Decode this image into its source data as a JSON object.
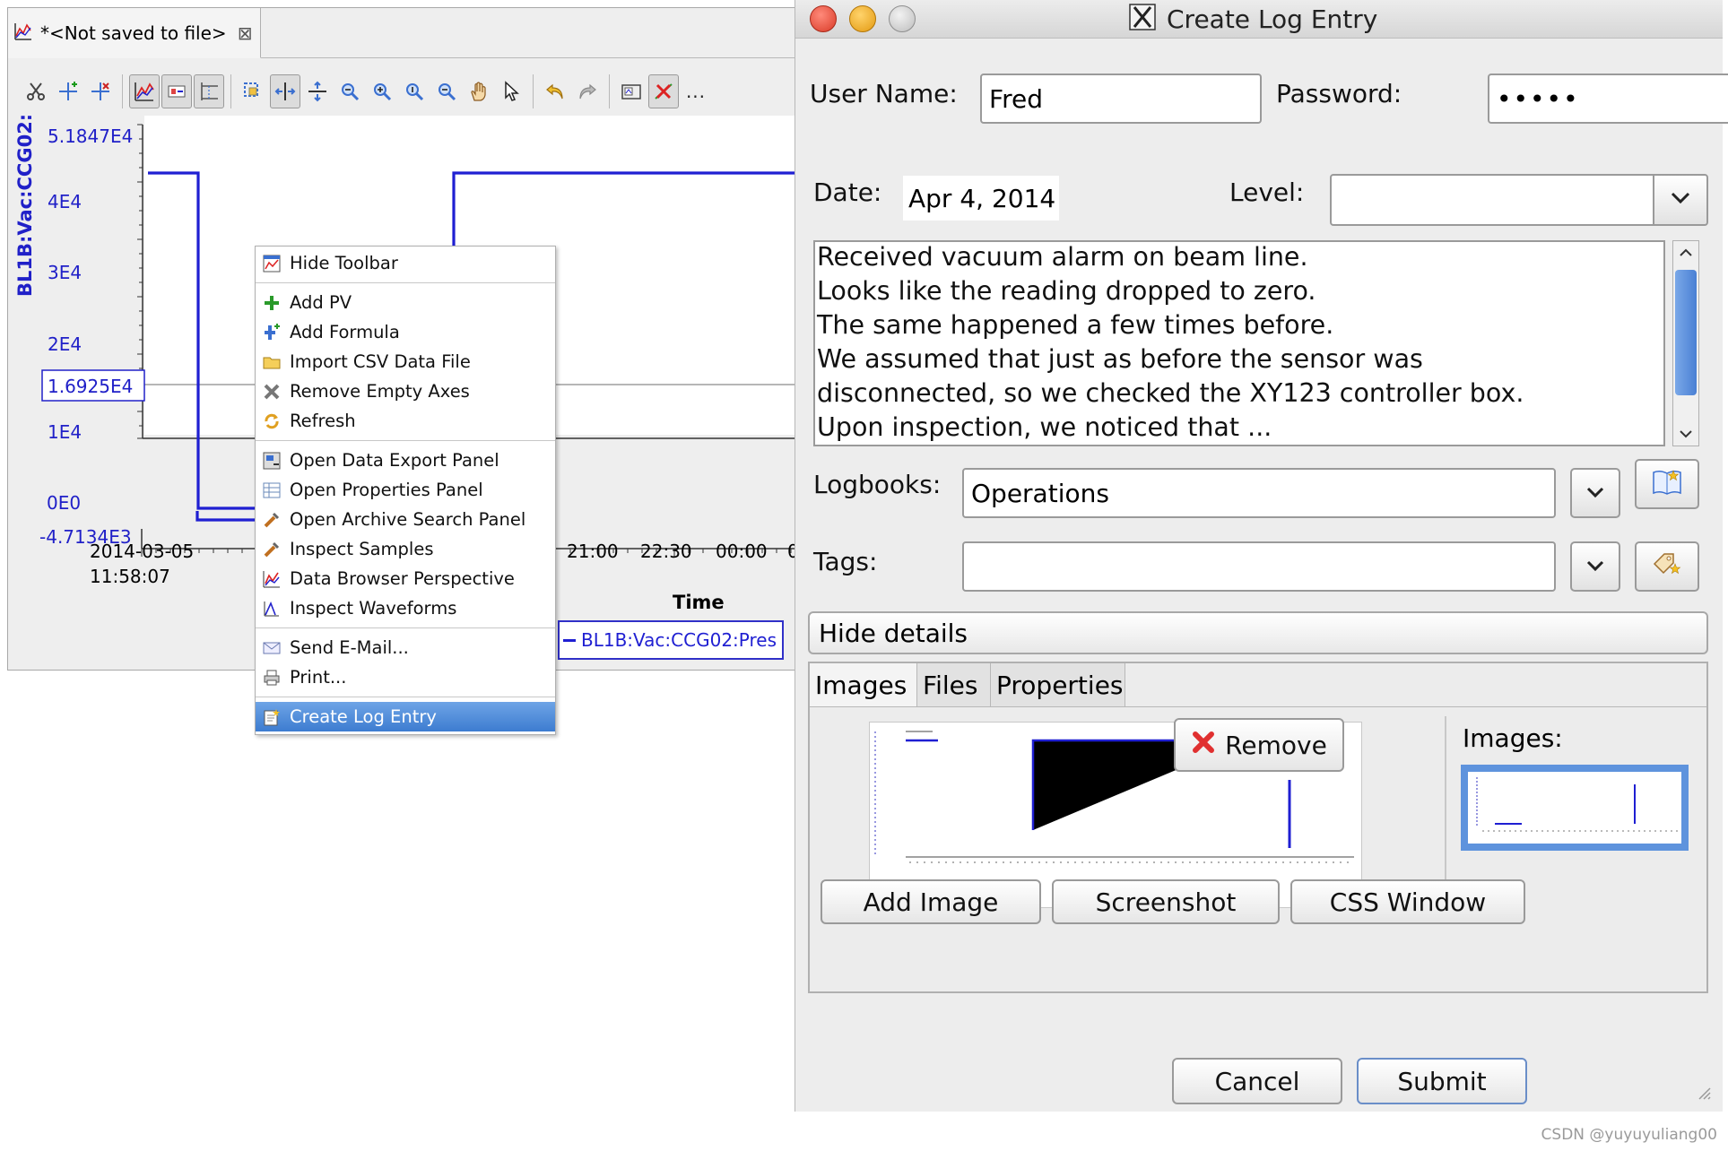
{
  "editor": {
    "tab_title": "*<Not saved to file>",
    "tab_close": "⊠"
  },
  "toolbar": {
    "icons": [
      "scissors-icon",
      "add-cursor-icon",
      "remove-cursor-icon",
      "chart-icon",
      "legend-icon",
      "grid-icon",
      "zoom-box-icon",
      "zoom-x-icon",
      "zoom-y-icon",
      "zoom-in-x-icon",
      "zoom-out-x-icon",
      "zoom-in-y-icon",
      "zoom-out-y-icon",
      "pan-icon",
      "pointer-icon",
      "undo-icon",
      "redo-icon",
      "snapshot-icon",
      "stop-icon"
    ],
    "more_label": "..."
  },
  "plot": {
    "y_axis_label": "BL1B:Vac:CCG02:Pres",
    "y_ticks": [
      "5.1847E4",
      "4E4",
      "3E4",
      "2E4",
      "1E4",
      "0E0",
      "-4.7134E3"
    ],
    "y_readout": "1.6925E4",
    "x_tick_first_date": "2014-03-05",
    "x_tick_first_time": "11:58:07",
    "x_ticks": [
      "21:00",
      "22:30",
      "00:00",
      "0"
    ],
    "x_axis_label": "Time",
    "legend": "BL1B:Vac:CCG02:Pres",
    "series_color": "#1f1fd2",
    "axis_color": "#2020c8"
  },
  "context_menu": {
    "groups": [
      [
        {
          "label": "Hide Toolbar",
          "icon": "toolbar-icon"
        }
      ],
      [
        {
          "label": "Add PV",
          "icon": "add-icon"
        },
        {
          "label": "Add Formula",
          "icon": "formula-icon"
        },
        {
          "label": "Import CSV Data File",
          "icon": "folder-icon"
        },
        {
          "label": "Remove Empty Axes",
          "icon": "remove-axes-icon"
        },
        {
          "label": "Refresh",
          "icon": "refresh-icon"
        }
      ],
      [
        {
          "label": "Open Data Export Panel",
          "icon": "export-icon"
        },
        {
          "label": "Open Properties Panel",
          "icon": "properties-icon"
        },
        {
          "label": "Open Archive Search Panel",
          "icon": "search-archive-icon"
        },
        {
          "label": "Inspect Samples",
          "icon": "inspect-icon"
        },
        {
          "label": "Data Browser Perspective",
          "icon": "chart-icon"
        },
        {
          "label": "Inspect Waveforms",
          "icon": "waveform-icon"
        }
      ],
      [
        {
          "label": "Send E-Mail...",
          "icon": "email-icon"
        },
        {
          "label": "Print...",
          "icon": "print-icon"
        }
      ],
      [
        {
          "label": "Create Log Entry",
          "icon": "log-entry-icon",
          "highlighted": true
        }
      ]
    ],
    "highlight_color": "#4a86d6"
  },
  "dialog": {
    "title": "Create Log Entry",
    "user_name_label": "User Name:",
    "user_name_value": "Fred",
    "password_label": "Password:",
    "password_value": "•••••",
    "date_label": "Date:",
    "date_value": "Apr 4, 2014",
    "level_label": "Level:",
    "level_value": "",
    "text_lines": [
      "Received vacuum alarm on beam line.",
      "Looks like the reading dropped to zero.",
      "The same happened a few times before.",
      "We assumed that just as before the sensor was",
      "disconnected, so we checked the XY123 controller box.",
      "Upon inspection, we noticed that ..."
    ],
    "logbooks_label": "Logbooks:",
    "logbooks_value": "Operations",
    "tags_label": "Tags:",
    "tags_value": "",
    "hide_details_label": "Hide details",
    "tabs": [
      "Images",
      "Files",
      "Properties"
    ],
    "remove_label": "Remove",
    "images_label": "Images:",
    "add_image_label": "Add Image",
    "screenshot_label": "Screenshot",
    "css_window_label": "CSS Window",
    "cancel_label": "Cancel",
    "submit_label": "Submit"
  },
  "footer": {
    "credit": "CSDN @yuyuyuliang00"
  }
}
